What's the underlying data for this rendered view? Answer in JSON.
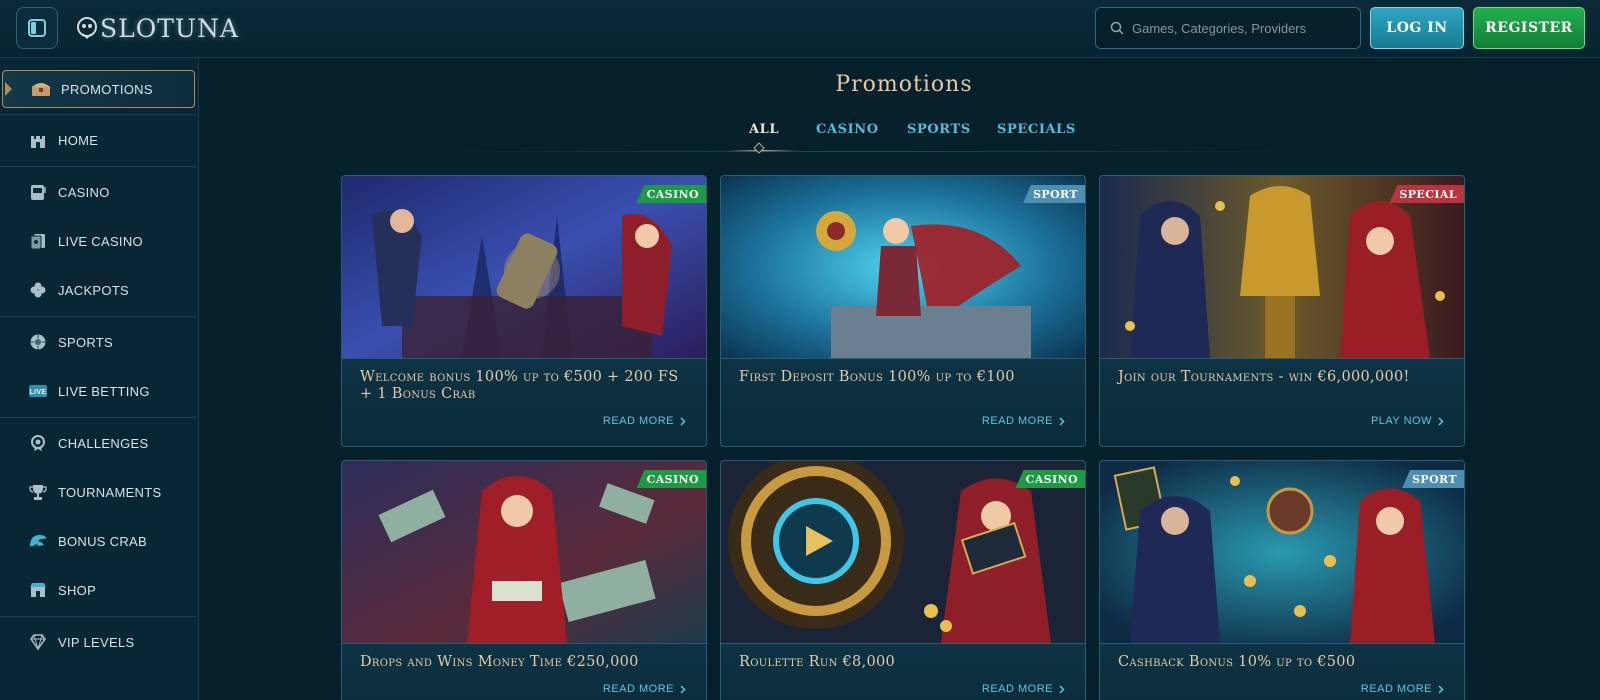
{
  "header": {
    "logo_text": "SLOTUNA",
    "search_placeholder": "Games, Categories, Providers",
    "login_label": "LOG IN",
    "register_label": "REGISTER"
  },
  "sidebar": {
    "items": [
      {
        "label": "PROMOTIONS",
        "icon": "treasure-chest-icon",
        "active": true
      },
      {
        "label": "HOME",
        "icon": "castle-icon"
      },
      {
        "label": "CASINO",
        "icon": "slot-machine-icon"
      },
      {
        "label": "LIVE CASINO",
        "icon": "cards-icon"
      },
      {
        "label": "JACKPOTS",
        "icon": "clover-icon"
      },
      {
        "label": "SPORTS",
        "icon": "ball-icon"
      },
      {
        "label": "LIVE BETTING",
        "icon": "live-icon"
      },
      {
        "label": "CHALLENGES",
        "icon": "medal-icon"
      },
      {
        "label": "TOURNAMENTS",
        "icon": "trophy-icon"
      },
      {
        "label": "BONUS CRAB",
        "icon": "crab-claw-icon"
      },
      {
        "label": "SHOP",
        "icon": "shop-icon"
      },
      {
        "label": "VIP LEVELS",
        "icon": "diamond-icon"
      }
    ]
  },
  "main": {
    "title": "Promotions",
    "tabs": [
      {
        "label": "ALL",
        "active": true
      },
      {
        "label": "CASINO"
      },
      {
        "label": "SPORTS"
      },
      {
        "label": "SPECIALS"
      }
    ],
    "cards": [
      {
        "badge": "CASINO",
        "badge_type": "casino",
        "title": "Welcome bonus 100% up to €500 + 200 FS + 1 Bonus Crab",
        "link": "READ MORE"
      },
      {
        "badge": "SPORT",
        "badge_type": "sport",
        "title": "First Deposit Bonus 100% up to €100",
        "link": "READ MORE"
      },
      {
        "badge": "SPECIAL",
        "badge_type": "special",
        "title": "Join our Tournaments - win €6,000,000!",
        "link": "PLAY NOW"
      },
      {
        "badge": "CASINO",
        "badge_type": "casino",
        "title": "Drops and Wins Money Time €250,000",
        "link": "READ MORE"
      },
      {
        "badge": "CASINO",
        "badge_type": "casino",
        "title": "Roulette Run €8,000",
        "link": "READ MORE"
      },
      {
        "badge": "SPORT",
        "badge_type": "sport",
        "title": "Cashback Bonus 10% up to €500",
        "link": "READ MORE"
      }
    ]
  },
  "colors": {
    "background": "#06202c",
    "accent_gold": "#e6c9a6",
    "accent_cyan": "#4fc0d8",
    "casino_badge": "#1c9b44",
    "sport_badge": "#4d8fb3",
    "special_badge": "#b8353b"
  }
}
